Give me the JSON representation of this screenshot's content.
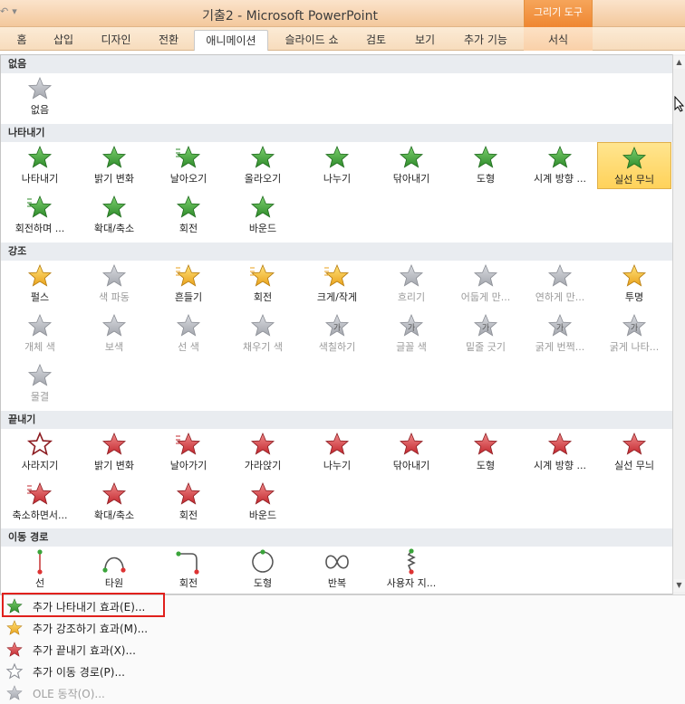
{
  "window": {
    "title": "기출2 - Microsoft PowerPoint",
    "context_tab_group": "그리기 도구"
  },
  "tabs": [
    {
      "label": "홈"
    },
    {
      "label": "삽입"
    },
    {
      "label": "디자인"
    },
    {
      "label": "전환"
    },
    {
      "label": "애니메이션",
      "active": true
    },
    {
      "label": "슬라이드 쇼"
    },
    {
      "label": "검토"
    },
    {
      "label": "보기"
    },
    {
      "label": "추가 기능"
    },
    {
      "label": "서식"
    }
  ],
  "sections": {
    "none": {
      "title": "없음",
      "items": [
        {
          "label": "없음",
          "icon": "star-gray-icon"
        }
      ]
    },
    "entrance": {
      "title": "나타내기",
      "items": [
        {
          "label": "나타내기",
          "icon": "star-green-icon"
        },
        {
          "label": "밝기 변화",
          "icon": "star-green-fade-icon"
        },
        {
          "label": "날아오기",
          "icon": "star-green-fly-icon"
        },
        {
          "label": "올라오기",
          "icon": "star-green-float-icon"
        },
        {
          "label": "나누기",
          "icon": "star-green-split-icon"
        },
        {
          "label": "닦아내기",
          "icon": "star-green-wipe-icon"
        },
        {
          "label": "도형",
          "icon": "star-green-shape-icon"
        },
        {
          "label": "시계 방향 ...",
          "icon": "star-green-wheel-icon"
        },
        {
          "label": "실선 무늬",
          "icon": "star-green-stripes-icon",
          "selected": true
        },
        {
          "label": "회전하며 ...",
          "icon": "star-green-spin-icon"
        },
        {
          "label": "확대/축소",
          "icon": "star-green-zoom-icon"
        },
        {
          "label": "회전",
          "icon": "star-green-swivel-icon"
        },
        {
          "label": "바운드",
          "icon": "star-green-bounce-icon"
        }
      ]
    },
    "emphasis": {
      "title": "강조",
      "items": [
        {
          "label": "펄스",
          "icon": "star-gold-icon"
        },
        {
          "label": "색 파동",
          "icon": "star-gray-icon",
          "disabled": true
        },
        {
          "label": "흔들기",
          "icon": "star-gold-teeter-icon"
        },
        {
          "label": "회전",
          "icon": "star-gold-spin-icon"
        },
        {
          "label": "크게/작게",
          "icon": "star-gold-grow-icon"
        },
        {
          "label": "흐리기",
          "icon": "star-gray-icon",
          "disabled": true
        },
        {
          "label": "어둡게 만...",
          "icon": "star-gray-icon",
          "disabled": true
        },
        {
          "label": "연하게 만...",
          "icon": "star-gray-icon",
          "disabled": true
        },
        {
          "label": "투명",
          "icon": "star-gold-half-icon"
        },
        {
          "label": "개체 색",
          "icon": "star-gray-icon",
          "disabled": true
        },
        {
          "label": "보색",
          "icon": "star-gray-icon",
          "disabled": true
        },
        {
          "label": "선 색",
          "icon": "star-gray-icon",
          "disabled": true
        },
        {
          "label": "채우기 색",
          "icon": "star-gray-icon",
          "disabled": true
        },
        {
          "label": "색칠하기",
          "icon": "star-gray-text-icon",
          "disabled": true
        },
        {
          "label": "글꼴 색",
          "icon": "star-gray-text-icon",
          "disabled": true
        },
        {
          "label": "밑줄 긋기",
          "icon": "star-gray-text-icon",
          "disabled": true
        },
        {
          "label": "굵게 번쩍...",
          "icon": "star-gray-text-icon",
          "disabled": true
        },
        {
          "label": "굵게 나타...",
          "icon": "star-gray-text-icon",
          "disabled": true
        },
        {
          "label": "물결",
          "icon": "star-gray-icon",
          "disabled": true
        }
      ]
    },
    "exit": {
      "title": "끝내기",
      "items": [
        {
          "label": "사라지기",
          "icon": "star-red-outline-icon"
        },
        {
          "label": "밝기 변화",
          "icon": "star-red-icon"
        },
        {
          "label": "날아가기",
          "icon": "star-red-fly-icon"
        },
        {
          "label": "가라앉기",
          "icon": "star-red-float-icon"
        },
        {
          "label": "나누기",
          "icon": "star-red-split-icon"
        },
        {
          "label": "닦아내기",
          "icon": "star-red-wipe-icon"
        },
        {
          "label": "도형",
          "icon": "star-red-shape-icon"
        },
        {
          "label": "시계 방향 ...",
          "icon": "star-red-wheel-icon"
        },
        {
          "label": "실선 무늬",
          "icon": "star-red-stripes-icon"
        },
        {
          "label": "축소하면서...",
          "icon": "star-red-spin-icon"
        },
        {
          "label": "확대/축소",
          "icon": "star-red-zoom-icon"
        },
        {
          "label": "회전",
          "icon": "star-red-swivel-icon"
        },
        {
          "label": "바운드",
          "icon": "star-red-bounce-icon"
        }
      ]
    },
    "paths": {
      "title": "이동 경로",
      "items": [
        {
          "label": "선",
          "icon": "path-line-icon"
        },
        {
          "label": "타원",
          "icon": "path-arc-icon"
        },
        {
          "label": "회전",
          "icon": "path-turn-icon"
        },
        {
          "label": "도형",
          "icon": "path-circle-icon"
        },
        {
          "label": "반복",
          "icon": "path-loop-icon"
        },
        {
          "label": "사용자 지...",
          "icon": "path-custom-icon"
        }
      ]
    }
  },
  "menu": [
    {
      "label": "추가 나타내기 효과(E)...",
      "icon": "star-green-small-icon",
      "highlighted": true
    },
    {
      "label": "추가 강조하기 효과(M)...",
      "icon": "star-yellow-small-icon"
    },
    {
      "label": "추가 끝내기 효과(X)...",
      "icon": "star-red-small-icon"
    },
    {
      "label": "추가 이동 경로(P)...",
      "icon": "star-outline-small-icon"
    },
    {
      "label": "OLE 동작(O)...",
      "icon": "ole-gear-icon",
      "disabled": true
    }
  ],
  "colors": {
    "green": "#3f9a3b",
    "gold": "#f2b632",
    "red": "#c8303a",
    "gray": "#a9acb3",
    "selection": "#ffd25a",
    "highlight_border": "#e0201c"
  }
}
